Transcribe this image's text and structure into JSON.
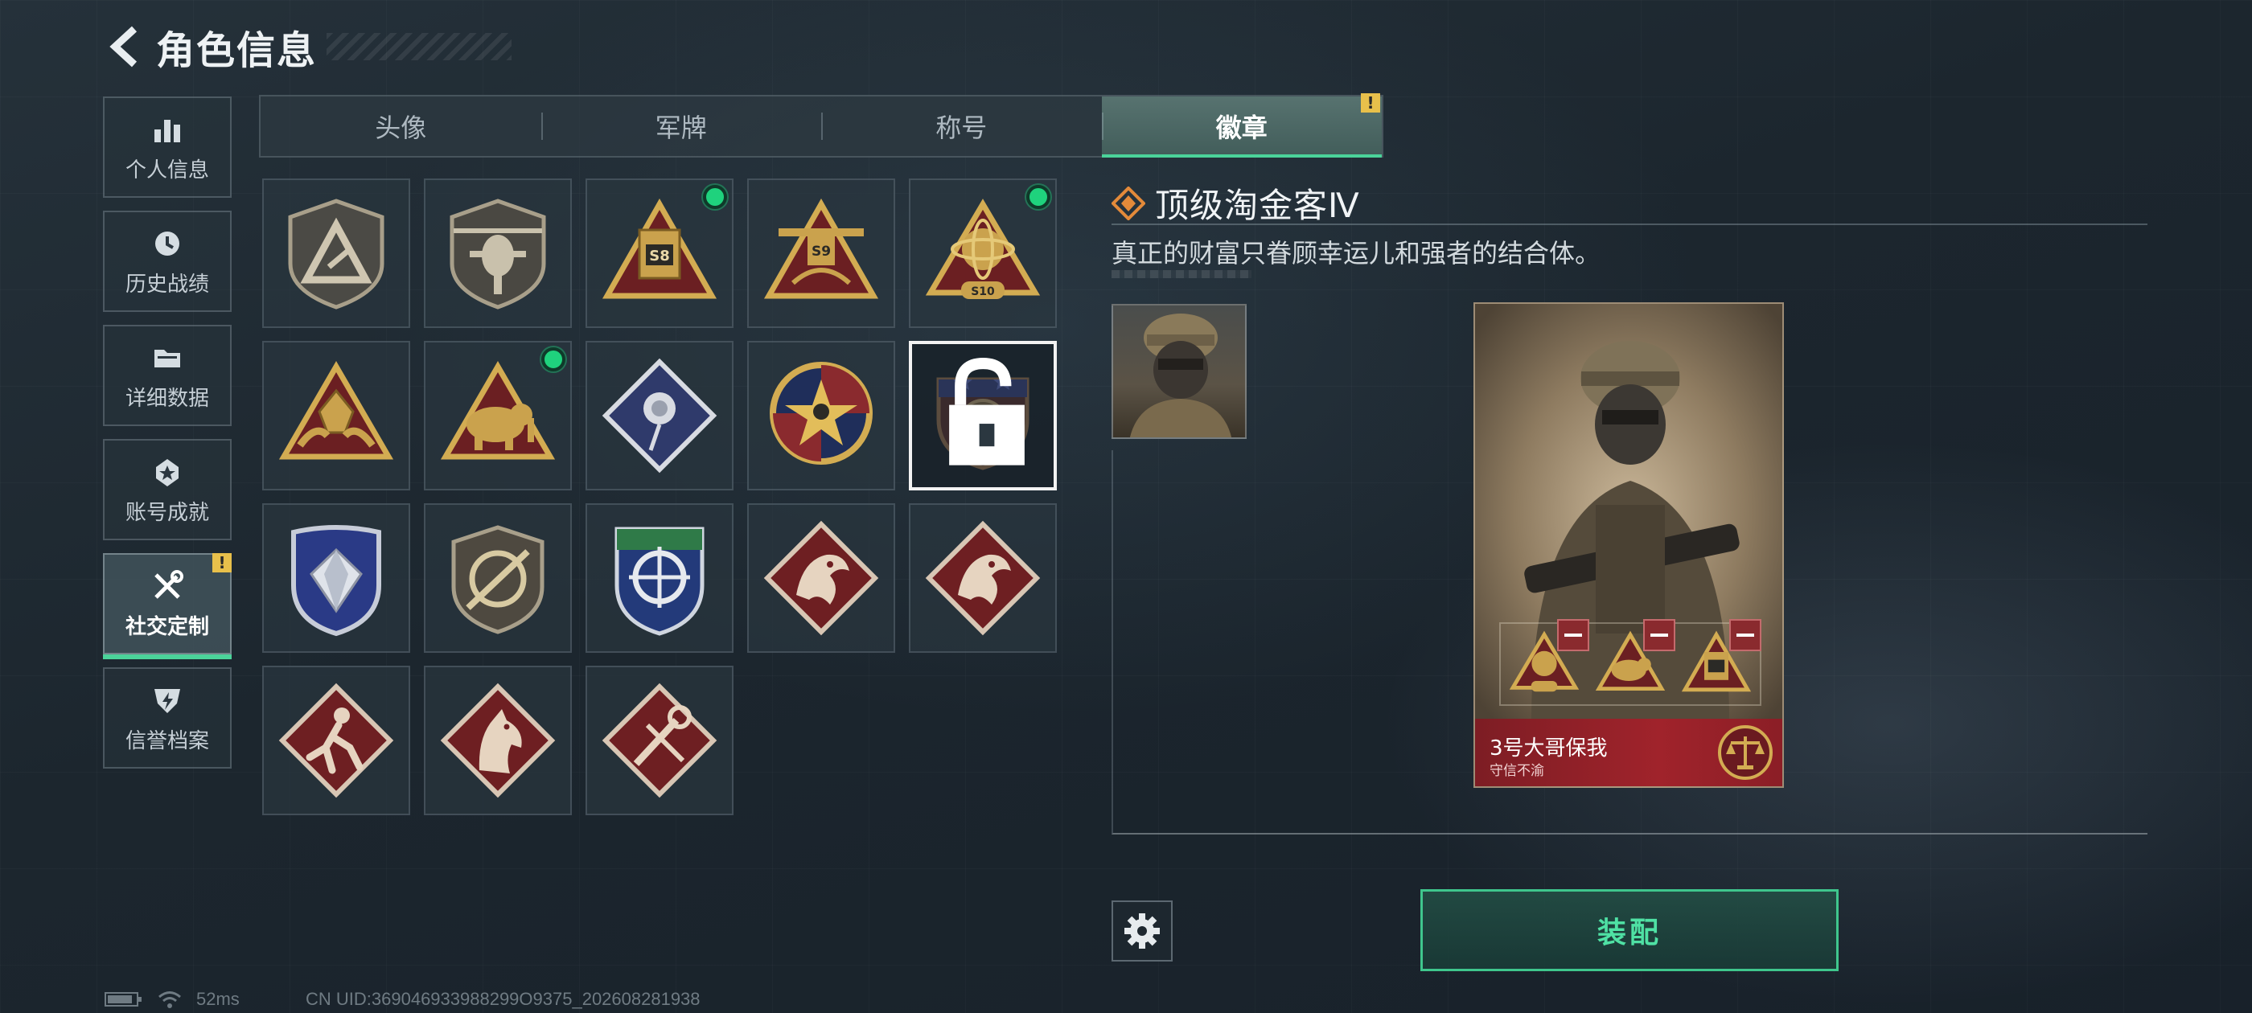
{
  "header": {
    "title": "角色信息",
    "back_icon": "chevron-left-icon"
  },
  "sidebar": {
    "items": [
      {
        "label": "个人信息",
        "icon": "bar-chart-icon",
        "active": false
      },
      {
        "label": "历史战绩",
        "icon": "clock-history-icon",
        "active": false
      },
      {
        "label": "详细数据",
        "icon": "folder-icon",
        "active": false
      },
      {
        "label": "账号成就",
        "icon": "medal-icon",
        "active": false
      },
      {
        "label": "社交定制",
        "icon": "tools-icon",
        "active": true,
        "badge": "!"
      },
      {
        "label": "信誉档案",
        "icon": "shield-bolt-icon",
        "active": false
      }
    ]
  },
  "tabs": {
    "items": [
      {
        "label": "头像",
        "active": false
      },
      {
        "label": "军牌",
        "active": false
      },
      {
        "label": "称号",
        "active": false
      },
      {
        "label": "徽章",
        "active": true,
        "badge": "!"
      }
    ]
  },
  "badges": {
    "items": [
      {
        "icon": "triangle-a-shield-badge-icon",
        "new": false
      },
      {
        "icon": "helicopter-shield-badge-icon",
        "new": false
      },
      {
        "icon": "s8-triangle-badge-icon",
        "new": true
      },
      {
        "icon": "s9-triangle-badge-icon",
        "new": false
      },
      {
        "icon": "s10-triangle-badge-icon",
        "new": true
      },
      {
        "icon": "gold-triangle-hands-badge-icon",
        "new": false
      },
      {
        "icon": "gold-triangle-elephant-badge-icon",
        "new": true
      },
      {
        "icon": "rose-diamond-badge-icon",
        "new": false
      },
      {
        "icon": "star-skull-round-badge-icon",
        "new": false
      },
      {
        "icon": "dark-crest-badge-icon",
        "new": false,
        "selected": true,
        "locked": true
      },
      {
        "icon": "blue-diamond-shield-badge-icon",
        "new": false
      },
      {
        "icon": "rifle-shield-badge-icon",
        "new": false
      },
      {
        "icon": "crosshair-shield-badge-icon",
        "new": false
      },
      {
        "icon": "red-dragon-badge-icon",
        "new": false
      },
      {
        "icon": "red-dragon-badge-2-icon",
        "new": false
      },
      {
        "icon": "red-runner-badge-icon",
        "new": false
      },
      {
        "icon": "red-horse-badge-icon",
        "new": false
      },
      {
        "icon": "red-wrench-badge-icon",
        "new": false
      }
    ]
  },
  "detail": {
    "name": "顶级淘金客Ⅳ",
    "description": "真正的财富只眷顾幸运儿和强者的结合体。",
    "title_icon": "orange-diamond-icon",
    "avatar_icon": "soldier-avatar-icon"
  },
  "card": {
    "player_name": "3号大哥保我",
    "subtitle": "守信不渝",
    "emblem_icon": "scales-emblem-icon",
    "slots": [
      "s10-triangle-badge-icon",
      "gold-triangle-elephant-badge-icon",
      "s8-triangle-badge-icon"
    ]
  },
  "actions": {
    "equip_label": "装配",
    "settings_icon": "gear-icon"
  },
  "status": {
    "battery_icon": "battery-icon",
    "wifi_icon": "wifi-icon",
    "ping": "52ms",
    "uid": "CN UID:369046933988299O9375_202608281938"
  },
  "colors": {
    "accent_green": "#4bd39a",
    "warning_yellow": "#e8c04b",
    "card_red": "#a0232b"
  }
}
